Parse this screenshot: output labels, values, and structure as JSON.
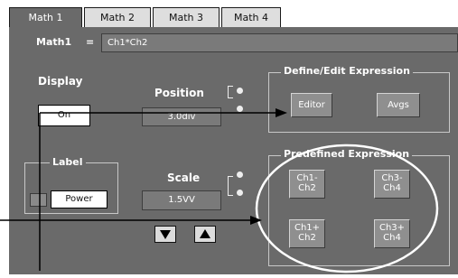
{
  "tabs": [
    "Math 1",
    "Math 2",
    "Math 3",
    "Math 4"
  ],
  "math": {
    "name": "Math1",
    "equals": "=",
    "expression": "Ch1*Ch2"
  },
  "display": {
    "label": "Display",
    "value": "On"
  },
  "position": {
    "label": "Position",
    "value": "3.0div"
  },
  "define_edit": {
    "title": "Define/Edit Expression",
    "editor": "Editor",
    "avgs": "Avgs"
  },
  "label_group": {
    "title": "Label",
    "value": "Power"
  },
  "scale": {
    "label": "Scale",
    "value": "1.5VV"
  },
  "predefined": {
    "title": "Predefined Expression",
    "buttons": [
      {
        "line1": "Ch1-",
        "line2": "Ch2"
      },
      {
        "line1": "Ch3-",
        "line2": "Ch4"
      },
      {
        "line1": "Ch1+",
        "line2": "Ch2"
      },
      {
        "line1": "Ch3+",
        "line2": "Ch4"
      }
    ]
  },
  "icons": {
    "down_arrow": "triangle-down",
    "up_arrow": "triangle-up"
  }
}
